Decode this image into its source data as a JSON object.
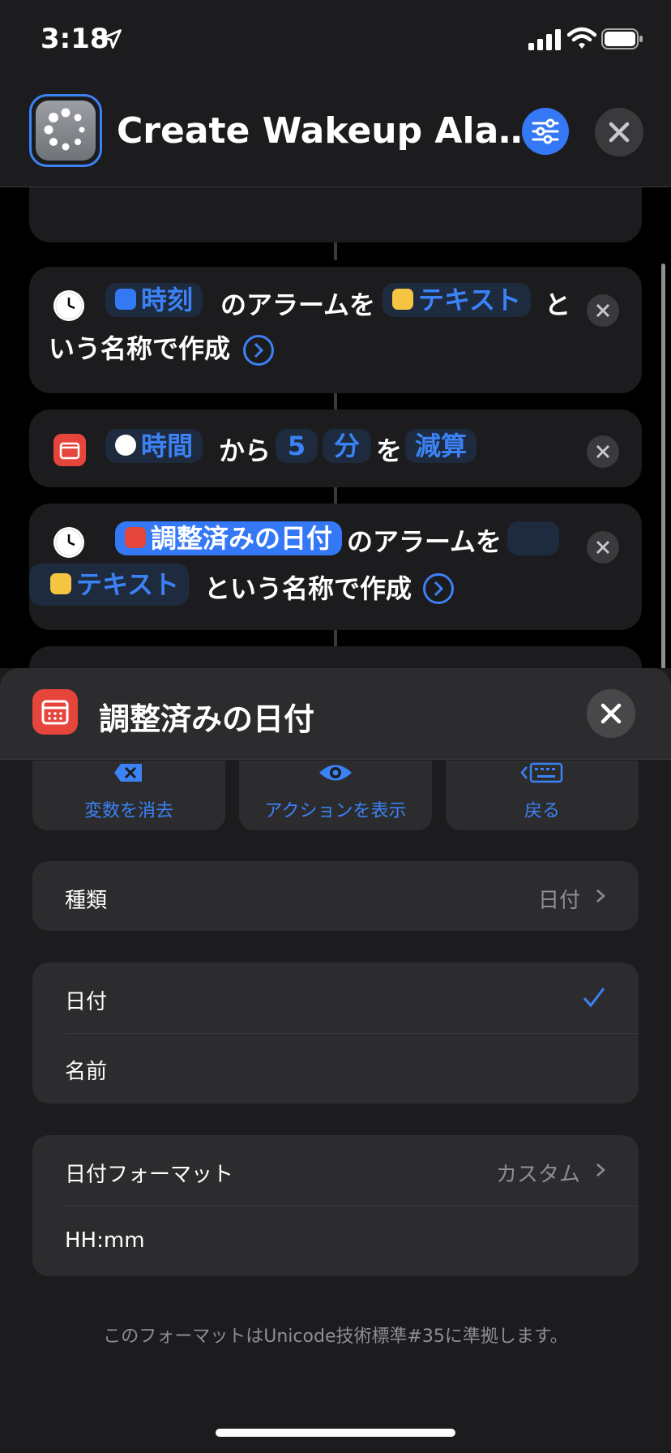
{
  "status_bar": {
    "time": "3:18",
    "icons": [
      "location-arrow-icon",
      "signal-icon",
      "wifi-icon",
      "battery-icon"
    ]
  },
  "header": {
    "title": "Create Wakeup Ala…",
    "app_icon": "shortcut-loading-icon",
    "settings_icon": "sliders-icon",
    "close_icon": "close-icon"
  },
  "actions": [
    {
      "icon": "clock-icon",
      "token_time": "時刻",
      "text1": "のアラームを",
      "token_text": "テキスト",
      "text2": "と",
      "text3": "いう名称で作成"
    },
    {
      "icon": "calendar-icon",
      "token_duration": "時間",
      "text1": "から",
      "token_amount": "5",
      "token_unit": "分",
      "text2": "を",
      "token_op": "減算"
    },
    {
      "icon": "clock-icon",
      "token_date": "調整済みの日付",
      "text1": "のアラームを",
      "token_text": "テキスト",
      "text2": "という名称で作成"
    }
  ],
  "sheet": {
    "title": "調整済みの日付",
    "buttons": [
      {
        "label": "変数を消去",
        "icon": "delete-left-icon"
      },
      {
        "label": "アクションを表示",
        "icon": "eye-icon"
      },
      {
        "label": "戻る",
        "icon": "keyboard-back-icon"
      }
    ],
    "type_row": {
      "label": "種類",
      "value": "日付"
    },
    "options": [
      {
        "label": "日付",
        "selected": true
      },
      {
        "label": "名前",
        "selected": false
      }
    ],
    "format_row": {
      "label": "日付フォーマット",
      "value": "カスタム"
    },
    "format_value": "HH:mm",
    "footnote": "このフォーマットはUnicode技術標準#35に準拠します。"
  },
  "colors": {
    "accent": "#3478f6",
    "calendar_red": "#e5453b",
    "background": "#000000",
    "card": "#1c1c1e"
  }
}
